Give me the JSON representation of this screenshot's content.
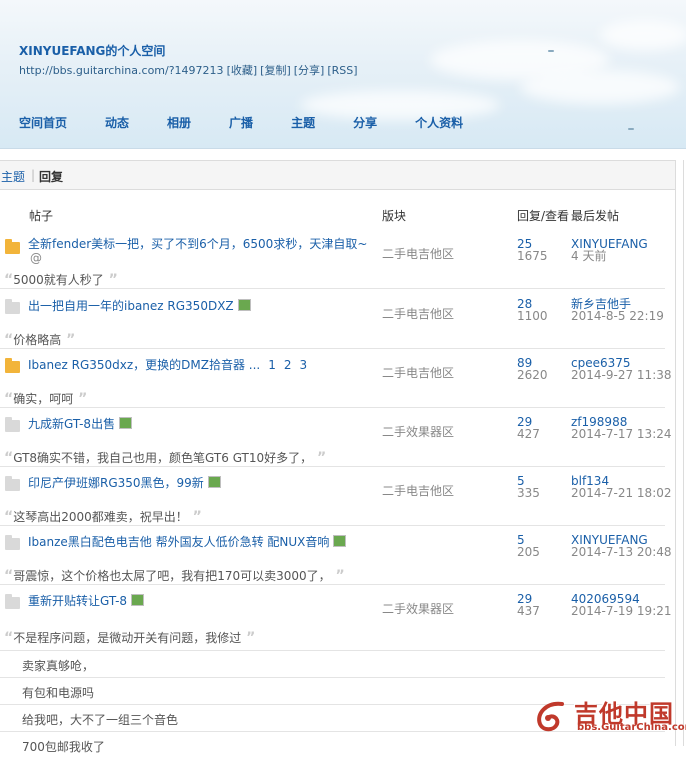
{
  "header": {
    "title": "XINYUEFANG的个人空间",
    "url": "http://bbs.guitarchina.com/?1497213",
    "url_actions": [
      "[收藏]",
      "[复制]",
      "[分享]",
      "[RSS]"
    ],
    "nav": [
      "空间首页",
      "动态",
      "相册",
      "广播",
      "主题",
      "分享",
      "个人资料"
    ]
  },
  "tabs": {
    "topics": "主题",
    "replies": "回复"
  },
  "columns": {
    "post": "帖子",
    "forum": "版块",
    "counts": "回复/查看",
    "last": "最后发帖"
  },
  "rows": [
    {
      "title": "全新fender美标一把，买了不到6个月，6500求秒，天津自取~",
      "more": "...",
      "forum": "二手电吉他区",
      "replies": "25",
      "views": "1675",
      "last_user": "XINYUEFANG",
      "last_time": "4 天前",
      "quote": "5000就有人秒了"
    },
    {
      "title": "出一把自用一年的ibanez RG350DXZ",
      "forum": "二手电吉他区",
      "replies": "28",
      "views": "1100",
      "last_user": "新乡吉他手",
      "last_time": "2014-8-5 22:19",
      "quote": "价格略高"
    },
    {
      "title": "Ibanez RG350dxz，更换的DMZ拾音器 ...",
      "pages": [
        "1",
        "2",
        "3"
      ],
      "forum": "二手电吉他区",
      "replies": "89",
      "views": "2620",
      "last_user": "cpee6375",
      "last_time": "2014-9-27 11:38",
      "quote": "确实，呵呵"
    },
    {
      "title": "九成新GT-8出售",
      "forum": "二手效果器区",
      "replies": "29",
      "views": "427",
      "last_user": "zf198988",
      "last_time": "2014-7-17 13:24",
      "quote": "GT8确实不错，我自己也用，颜色笔GT6 GT10好多了，"
    },
    {
      "title": "印尼产伊班娜RG350黑色，99新",
      "forum": "二手电吉他区",
      "replies": "5",
      "views": "335",
      "last_user": "blf134",
      "last_time": "2014-7-21 18:02",
      "quote": "这琴高出2000都难卖，祝早出！"
    },
    {
      "title": "Ibanze黑白配色电吉他 帮外国友人低价急转 配NUX音响",
      "forum": "",
      "replies": "5",
      "views": "205",
      "last_user": "XINYUEFANG",
      "last_time": "2014-7-13 20:48",
      "quote": "哥震惊，这个价格也太屌了吧，我有把170可以卖3000了，"
    },
    {
      "title": "重新开贴转让GT-8",
      "forum": "二手效果器区",
      "replies": "29",
      "views": "437",
      "last_user": "402069594",
      "last_time": "2014-7-19 19:21",
      "quote": "不是程序问题，是微动开关有问题，我修过"
    }
  ],
  "extra_replies": [
    "卖家真够呛，",
    "有包和电源吗",
    "给我吧，大不了一组三个音色",
    "700包邮我收了"
  ],
  "logo": {
    "main": "吉他中国",
    "sub": "bbs.GuitarChina.com"
  }
}
